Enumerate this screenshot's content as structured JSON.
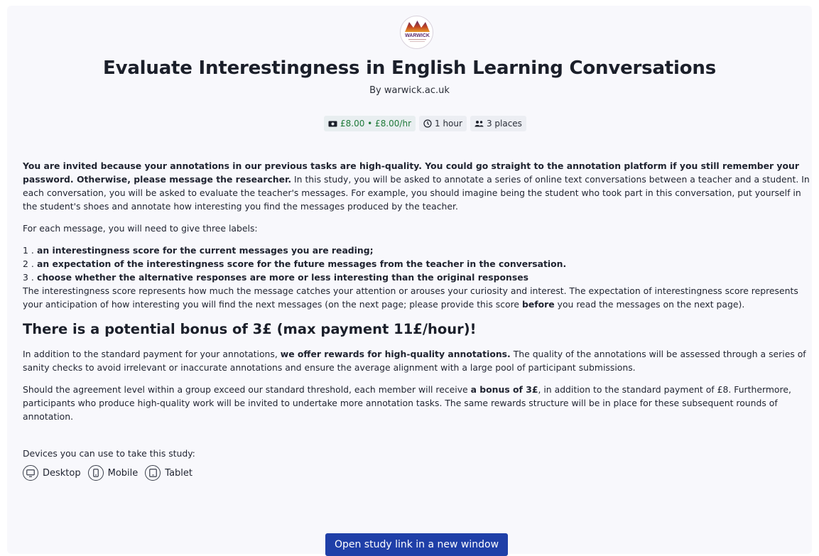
{
  "logo": {
    "text": "WARWICK",
    "colors": {
      "top": "#5b2a6e",
      "mid": "#c2451f",
      "bottom": "#e79a2b"
    }
  },
  "header": {
    "title": "Evaluate Interestingness in English Learning Conversations",
    "byline": "By warwick.ac.uk"
  },
  "chips": {
    "pay": "£8.00 • £8.00/hr",
    "duration": "1 hour",
    "places": "3 places"
  },
  "description": {
    "intro_bold": "You are invited because your annotations in our previous tasks are high-quality. You could go straight to the annotation platform if you still remember your password. Otherwise, please message the researcher.",
    "intro_rest": " In this study, you will be asked to annotate a series of online text conversations between a teacher and a student. In each conversation, you will be asked to evaluate the teacher's messages. For example, you should imagine being the student who took part in this conversation, put yourself in the student's shoes and annotate how interesting you find the messages produced by the teacher.",
    "labels_intro": "For each message, you will need to give three labels:",
    "labels": [
      {
        "num": "1 .",
        "text": "an interestingness score for the current messages you are reading;"
      },
      {
        "num": "2 .",
        "text": "an expectation of the interestingness score for the future messages from the teacher in the conversation."
      },
      {
        "num": "3 .",
        "text": "choose whether the alternative responses are more or less interesting than the original responses"
      }
    ],
    "score_expl_a": "The interestingness score represents how much the message catches your attention or arouses your curiosity and interest. The expectation of interestingness score represents your anticipation of how interesting you will find the next messages (on the next page; please provide this score ",
    "score_expl_bold": "before",
    "score_expl_b": " you read the messages on the next page)."
  },
  "bonus": {
    "heading": "There is a potential bonus of 3£ (max payment 11£/hour)!",
    "p1_a": "In addition to the standard payment for your annotations, ",
    "p1_bold": "we offer rewards for high-quality annotations.",
    "p1_b": " The quality of the annotations will be assessed through a series of sanity checks to avoid irrelevant or inaccurate annotations and ensure the average alignment with a large pool of participant submissions.",
    "p2_a": "Should the agreement level within a group exceed our standard threshold, each member will receive ",
    "p2_bold": "a bonus of 3£",
    "p2_b": ", in addition to the standard payment of £8. Furthermore, participants who produce high-quality work will be invited to undertake more annotation tasks. The same rewards structure will be in place for these subsequent rounds of annotation."
  },
  "devices": {
    "label": "Devices you can use to take this study:",
    "items": [
      {
        "label": "Desktop",
        "icon": "desktop-icon"
      },
      {
        "label": "Mobile",
        "icon": "mobile-icon"
      },
      {
        "label": "Tablet",
        "icon": "tablet-icon"
      }
    ]
  },
  "action": {
    "open_label": "Open study link in a new window",
    "color": "#1f3fa8"
  }
}
